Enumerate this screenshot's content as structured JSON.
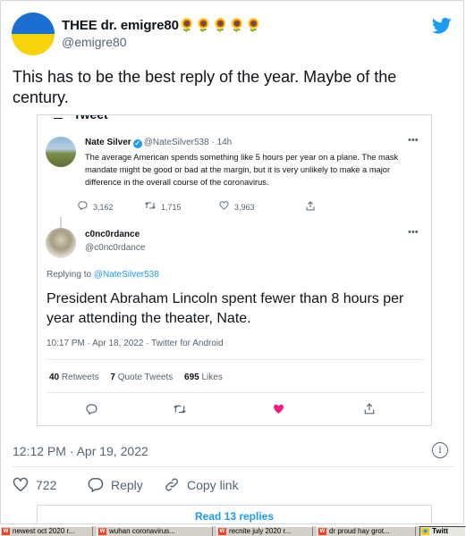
{
  "tweet": {
    "author_name": "THEE dr. emigre80",
    "author_flowers": "🌻🌻🌻🌻🌻",
    "handle": "@emigre80",
    "text": "This has to be the best reply of the year. Maybe of the century.",
    "timestamp": "12:12 PM · Apr 19, 2022",
    "likes": "722",
    "reply_label": "Reply",
    "copy_link_label": "Copy link",
    "read_replies_label": "Read 13 replies"
  },
  "embedded": {
    "header": "Tweet",
    "quoted": {
      "name": "Nate Silver",
      "handle": "@NateSilver538 · 14h",
      "text": "The average American spends something like 5 hours per year on a plane. The mask mandate might be good or bad at the margin, but it is very unlikely to make a major difference in the overall course of the coronavirus.",
      "replies": "3,162",
      "retweets": "1,715",
      "likes": "3,963"
    },
    "reply": {
      "name": "c0nc0rdance",
      "handle": "@c0nc0rdance",
      "replying_prefix": "Replying to",
      "replying_to": "@NateSilver538",
      "text": "President Abraham Lincoln spent fewer than 8 hours per year attending the theater, Nate.",
      "time_source": "10:17 PM · Apr 18, 2022 · Twitter for Android",
      "retweets_count": "40",
      "retweets_label": "Retweets",
      "quote_count": "7",
      "quote_label": "Quote Tweets",
      "likes_count": "695",
      "likes_label": "Likes"
    }
  },
  "taskbar": {
    "items": [
      {
        "label": "newest oct 2020 r..."
      },
      {
        "label": "wuhan coronavirus..."
      },
      {
        "label": "recnite july 2020 r..."
      },
      {
        "label": "dr proud hay grot..."
      },
      {
        "label": "Twitt"
      }
    ]
  },
  "colors": {
    "accent": "#1d9bf0",
    "like": "#f91880",
    "muted": "#536471",
    "border": "#cfd9de"
  }
}
